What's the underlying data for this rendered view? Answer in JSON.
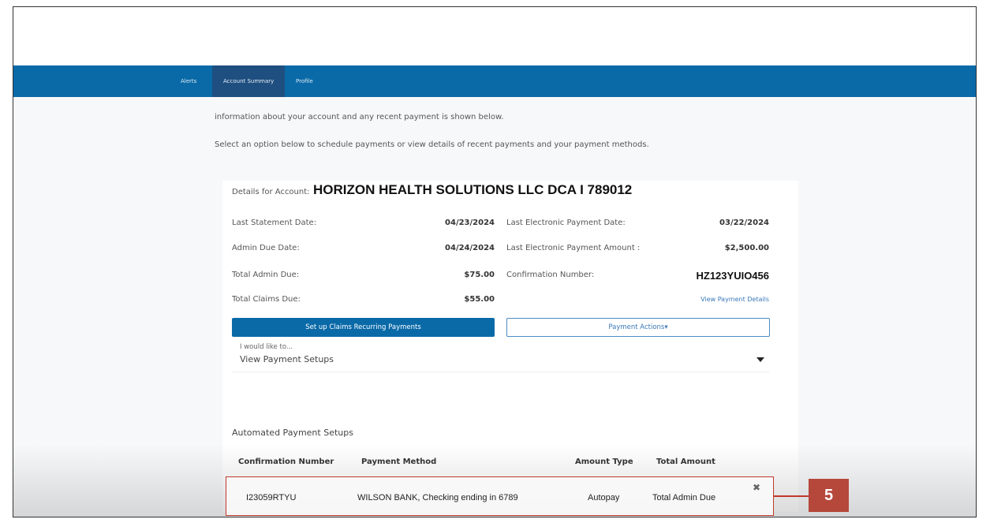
{
  "nav": {
    "items": [
      "Alerts",
      "Account Summary",
      "Profile"
    ],
    "active_index": 1
  },
  "intro": {
    "line1": "information about your account and any recent payment is shown below.",
    "line2": "Select an option below to schedule payments or view details of recent payments and your payment methods."
  },
  "account": {
    "label": "Details for Account:",
    "name": "HORIZON HEALTH SOLUTIONS LLC DCA I 789012"
  },
  "details": {
    "last_statement_label": "Last Statement Date:",
    "last_statement_value": "04/23/2024",
    "admin_due_date_label": "Admin Due Date:",
    "admin_due_date_value": "04/24/2024",
    "total_admin_due_label": "Total Admin Due:",
    "total_admin_due_value": "$75.00",
    "total_claims_due_label": "Total Claims Due:",
    "total_claims_due_value": "$55.00",
    "last_payment_date_label": "Last Electronic Payment Date:",
    "last_payment_date_value": "03/22/2024",
    "last_payment_amount_label": "Last Electronic Payment Amount :",
    "last_payment_amount_value": "$2,500.00",
    "confirmation_label": "Confirmation Number:",
    "confirmation_value": "HZ123YUIO456",
    "view_details_link": "View Payment Details"
  },
  "actions": {
    "setup_button": "Set up Claims Recurring Payments",
    "payment_actions_button": "Payment Actions▾"
  },
  "dropdown": {
    "label": "I would like to...",
    "value": "View Payment Setups"
  },
  "setups": {
    "title": "Automated Payment Setups",
    "headers": [
      "Confirmation Number",
      "Payment Method",
      "Amount Type",
      "Total Amount"
    ],
    "row": {
      "confirmation": "I23059RTYU",
      "method": "WILSON BANK, Checking ending in 6789",
      "amount_type": "Autopay",
      "total_amount": "Total Admin Due"
    },
    "remove_icon": "✖"
  },
  "callout": {
    "number": "5",
    "color": "#b5473b"
  }
}
